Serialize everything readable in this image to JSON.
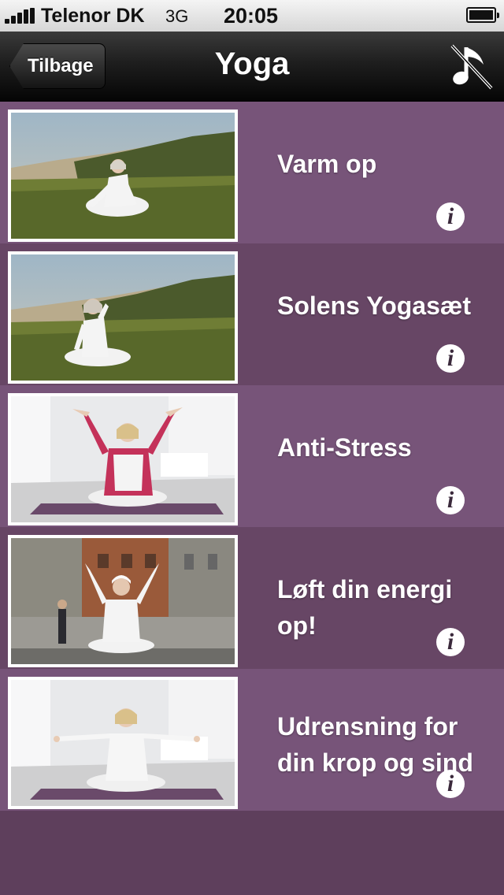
{
  "status_bar": {
    "carrier": "Telenor DK",
    "network": "3G",
    "time": "20:05"
  },
  "nav": {
    "back_label": "Tilbage",
    "title": "Yoga",
    "mute_icon": "music-note-muted-icon"
  },
  "items": [
    {
      "title": "Varm op"
    },
    {
      "title": "Solens Yogasæt"
    },
    {
      "title": "Anti-Stress"
    },
    {
      "title": "Løft din energi op!"
    },
    {
      "title": "Udrensning for din krop og sind"
    }
  ],
  "info_glyph": "i",
  "colors": {
    "row_light": "#775479",
    "row_dark": "#674665",
    "background": "#5e3f5c"
  }
}
